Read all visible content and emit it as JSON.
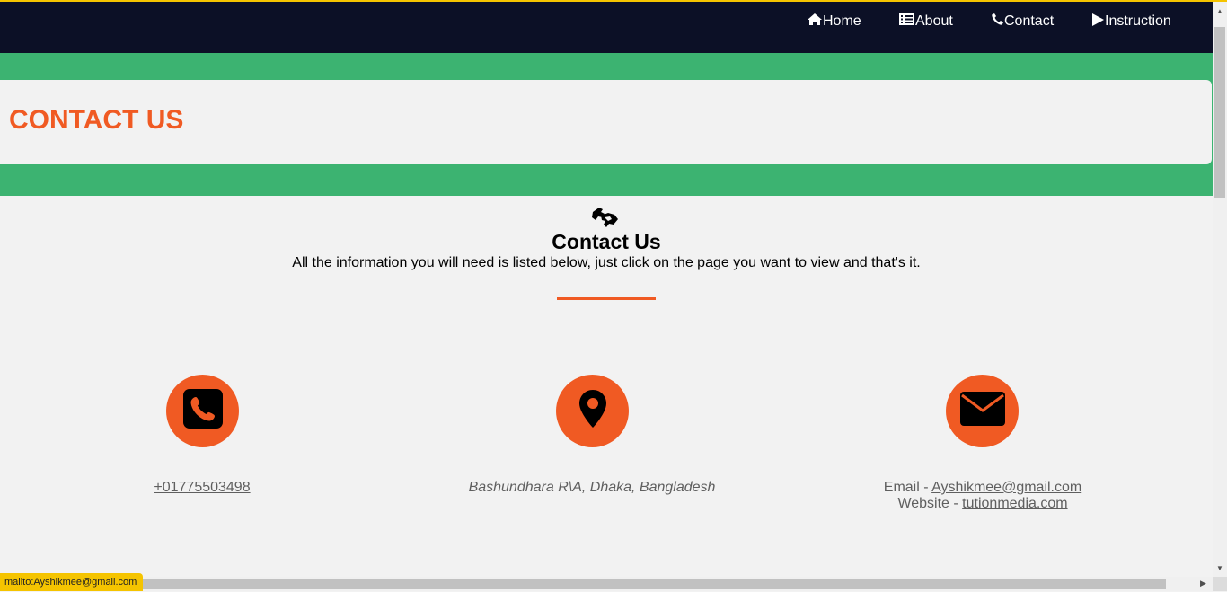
{
  "nav": {
    "items": [
      {
        "label": "Home",
        "icon": "home-icon"
      },
      {
        "label": "About",
        "icon": "list-icon"
      },
      {
        "label": "Contact",
        "icon": "phone-icon"
      },
      {
        "label": "Instruction",
        "icon": "play-icon"
      }
    ]
  },
  "banner": {
    "title": "CONTACT US"
  },
  "section": {
    "icon": "sign-language-icon",
    "title": "Contact Us",
    "subtitle": "All the information you will need is listed below, just click on the page you want to view and that's it."
  },
  "contact": {
    "phone": "+01775503498",
    "address": "Bashundhara R\\A, Dhaka, Bangladesh",
    "email_label": "Email - ",
    "email": "Ayshikmee@gmail.com",
    "website_label": "Website - ",
    "website": "tutionmedia.com"
  },
  "status_bar": {
    "text": "mailto:Ayshikmee@gmail.com"
  },
  "colors": {
    "nav_bg": "#0c1026",
    "banner_green": "#3cb371",
    "accent_orange": "#f05a23",
    "status_yellow": "#f5c400"
  }
}
